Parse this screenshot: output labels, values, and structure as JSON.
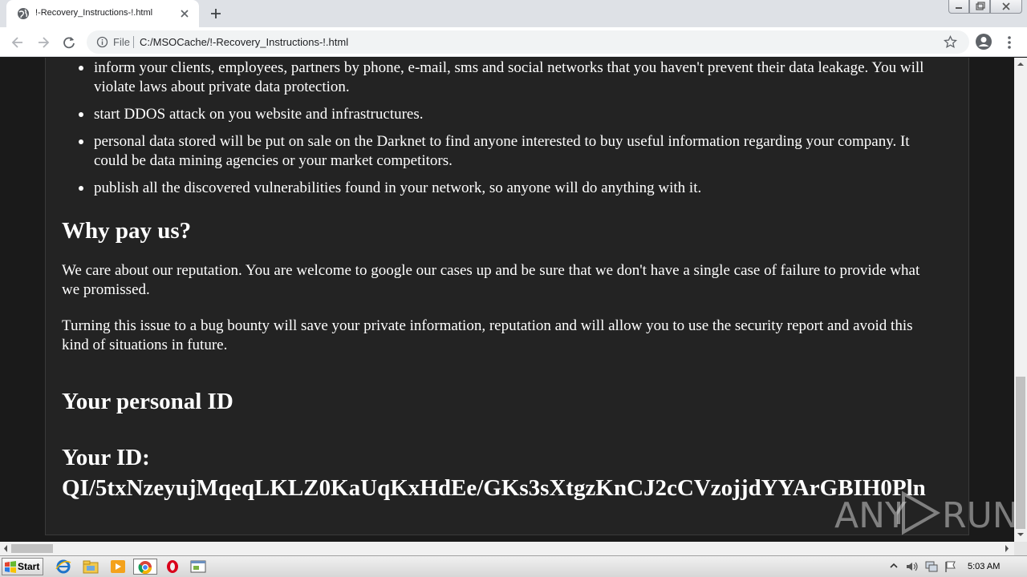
{
  "browser": {
    "tab_title": "!-Recovery_Instructions-!.html",
    "omnibox_prefix": "File",
    "url": "C:/MSOCache/!-Recovery_Instructions-!.html",
    "icons": [
      "globe-icon",
      "close-icon",
      "plus-icon",
      "back-arrow-icon",
      "forward-arrow-icon",
      "reload-icon",
      "info-icon",
      "star-icon",
      "account-icon",
      "kebab-menu-icon"
    ]
  },
  "page": {
    "bullets": [
      "inform your clients, employees, partners by phone, e-mail, sms and social networks that you haven't prevent their data leakage. You will violate laws about private data protection.",
      "start DDOS attack on you website and infrastructures.",
      "personal data stored will be put on sale on the Darknet to find anyone interested to buy useful information regarding your company. It could be data mining agencies or your market competitors.",
      "publish all the discovered vulnerabilities found in your network, so anyone will do anything with it."
    ],
    "why_heading": "Why pay us?",
    "why_paragraphs": [
      "We care about our reputation. You are welcome to google our cases up and be sure that we don't have a single case of failure to provide what we promissed.",
      "Turning this issue to a bug bounty will save your private information, reputation and will allow you to use the security report and avoid this kind of situations in future."
    ],
    "id_heading": "Your personal ID",
    "id_label": "Your ID:",
    "id_value": "QI/5txNzeyujMqeqLKLZ0KaUqKxHdEe/GKs3sXtgzKnCJ2cCVzojjdYYArGBIH0Pln",
    "watermark": "ANY RUN"
  },
  "taskbar": {
    "start_label": "Start",
    "clock": "5:03 AM"
  },
  "colors": {
    "page_bg": "#1a1a1a",
    "panel_bg": "#232323",
    "text": "#ffffff"
  }
}
